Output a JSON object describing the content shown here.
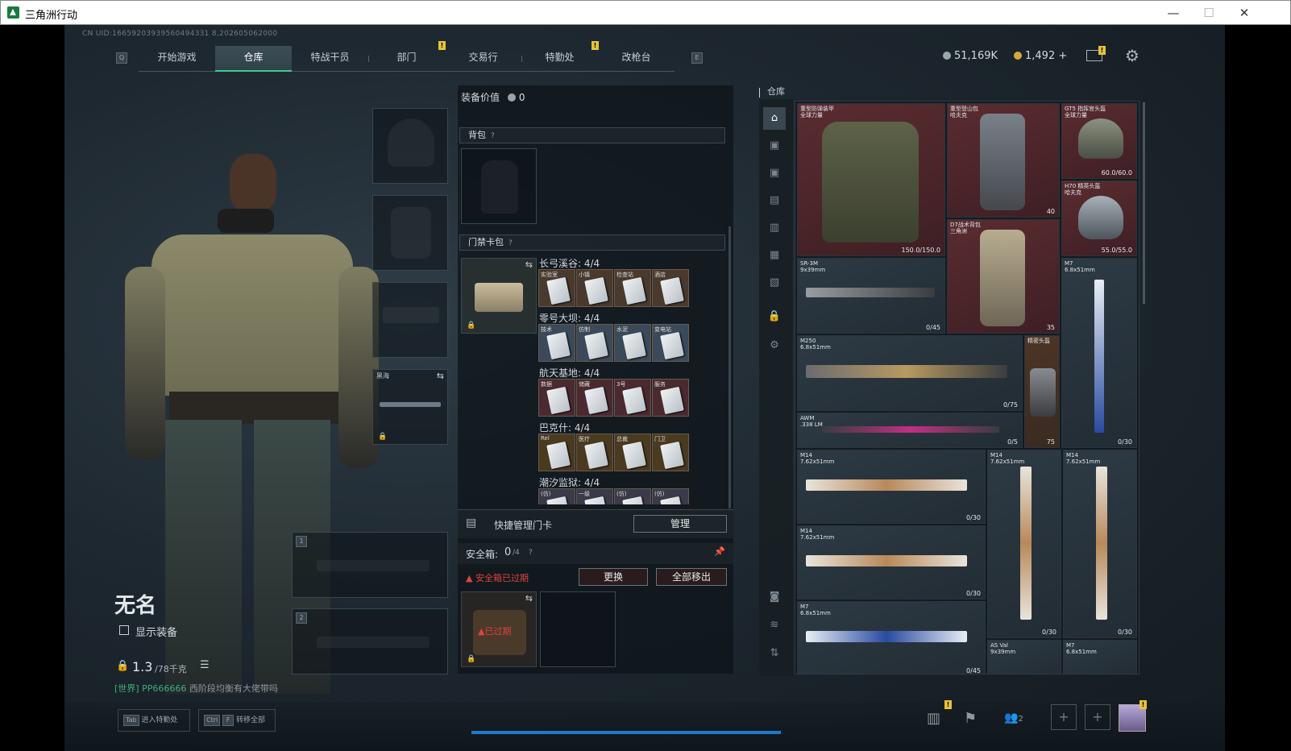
{
  "window": {
    "title": "三角洲行动",
    "buttons": {
      "minimize": "—",
      "maximize": "☐",
      "close": "✕"
    }
  },
  "uid": "CN UID:16659203939560494331 8,202605062000",
  "nav": {
    "left_key": "Q",
    "right_key": "E",
    "tabs": [
      {
        "label": "开始游戏"
      },
      {
        "label": "仓库"
      },
      {
        "label": "特战干员"
      },
      {
        "label": "部门"
      },
      {
        "label": "交易行"
      },
      {
        "label": "特勤处"
      },
      {
        "label": "改枪台"
      }
    ]
  },
  "currency": {
    "silver": "51,169K",
    "gold": "1,492",
    "gold_add": "+"
  },
  "notif_mark": "!",
  "character": {
    "name": "无名",
    "show_gear_label": "显示装备",
    "weight": "1.3",
    "weight_unit": "/78千克",
    "chat_channel": "[世界]",
    "chat_user": "PP666666",
    "chat_msg": "西阶段均衡有大佬带吗"
  },
  "slots": {
    "melee_name": "黑海",
    "gun1": "1",
    "gun2": "2"
  },
  "equip": {
    "value_label": "装备价值",
    "value": "0",
    "backpack": "背包",
    "keycard_pack": "门禁卡包",
    "maps": [
      {
        "name": "长弓溪谷: 4/4",
        "cards": [
          "实验室",
          "小镇",
          "检查站",
          "酒店"
        ],
        "color": "#4a3a2e"
      },
      {
        "name": "零号大坝: 4/4",
        "cards": [
          "技术",
          "仿制",
          "水泥",
          "变电站"
        ],
        "color": "#3a4a5a"
      },
      {
        "name": "航天基地: 4/4",
        "cards": [
          "数据",
          "储藏",
          "3号",
          "服务"
        ],
        "color": "#4a2a30"
      },
      {
        "name": "巴克什: 4/4",
        "cards": [
          "Rel",
          "医疗",
          "总裁",
          "门卫"
        ],
        "color": "#4a3a20"
      },
      {
        "name": "潮汐监狱: 4/4",
        "cards": [
          "(仿)",
          "一级",
          "(仿)",
          "(仿)"
        ],
        "color": "#3a3a4a"
      }
    ],
    "quick_manage": "快捷管理门卡",
    "manage_btn": "管理",
    "safebox_label": "安全箱:",
    "safebox_value": "0",
    "safebox_max": "/4",
    "expired_warning": "安全箱已过期",
    "replace_btn": "更换",
    "remove_all_btn": "全部移出",
    "expired_tag": "已过期"
  },
  "warehouse": {
    "title": "仓库",
    "items": [
      {
        "name": "重型防弹装甲\n全球力量",
        "durability": "150.0/150.0"
      },
      {
        "name": "重型登山包\n哈夫克",
        "capacity": "40"
      },
      {
        "name": "GT5 指挥官头盔\n全球力量",
        "durability": "60.0/60.0"
      },
      {
        "name": "H70 精英头盔\n哈夫克",
        "durability": "55.0/55.0"
      },
      {
        "name": "SR-3M\n9x39mm",
        "ammo": "0/45"
      },
      {
        "name": "D7战术背包\n三角洲",
        "capacity": "35"
      },
      {
        "name": "M7\n6.8x51mm",
        "ammo": "0/30"
      },
      {
        "name": "M250\n6.8x51mm",
        "ammo": "0/75"
      },
      {
        "name": "精密头盔",
        "ammo": "75"
      },
      {
        "name": "AWM\n.338 LM",
        "ammo": "0/5"
      },
      {
        "name": "M14\n7.62x51mm",
        "ammo": "0/30"
      },
      {
        "name": "M14\n7.62x51mm",
        "ammo": "0/30"
      },
      {
        "name": "M14\n7.62x51mm",
        "ammo": "0/30"
      },
      {
        "name": "M14\n7.62x51mm",
        "ammo": "0/30"
      },
      {
        "name": "M7\n6.8x51mm",
        "ammo": "0/45"
      },
      {
        "name": "AS Val\n9x39mm",
        "ammo": ""
      },
      {
        "name": "M7\n6.8x51mm",
        "ammo": ""
      }
    ]
  },
  "footer": {
    "tab_key": "Tab",
    "tab_label": "进入特勤处",
    "ctrl_key": "Ctrl",
    "f_key": "F",
    "transfer_label": "转移全部",
    "friends": "2"
  }
}
